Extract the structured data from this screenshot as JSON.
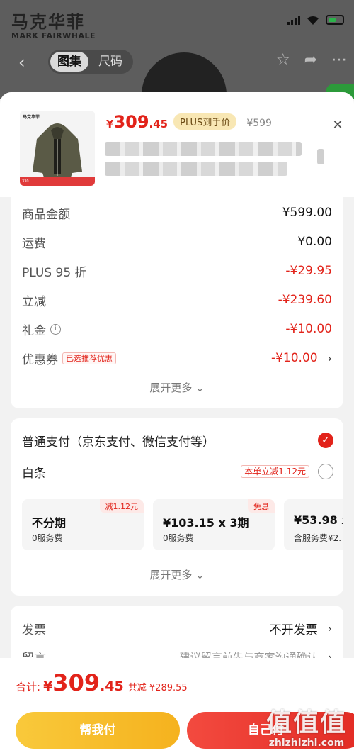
{
  "background": {
    "brand_cn": "马克华菲",
    "brand_en": "MARK FAIRWHALE",
    "tabs": [
      "图集",
      "尺码"
    ]
  },
  "product": {
    "thumb_brand": "马克华菲",
    "price_currency": "¥",
    "price_int": "309",
    "price_dec": ".45",
    "plus_tag": "PLUS到手价",
    "original_price": "¥599"
  },
  "summary": {
    "rows": [
      {
        "label": "商品金额",
        "value": "¥599.00"
      },
      {
        "label": "运费",
        "value": "¥0.00"
      },
      {
        "label": "PLUS 95 折",
        "value": "-¥29.95"
      },
      {
        "label": "立减",
        "value": "-¥239.60"
      },
      {
        "label": "礼金",
        "value": "-¥10.00"
      },
      {
        "label": "优惠券",
        "tag": "已选推荐优惠",
        "value": "-¥10.00"
      }
    ],
    "expand": "展开更多"
  },
  "payment": {
    "normal": "普通支付（京东支付、微信支付等）",
    "baitiao": "白条",
    "baitiao_tag": "本单立减1.12元",
    "installments": [
      {
        "title": "不分期",
        "sub": "0服务费",
        "corner": "减1.12元"
      },
      {
        "title": "¥103.15 x 3期",
        "sub": "0服务费",
        "corner": "免息"
      },
      {
        "title": "¥53.98 x",
        "sub": "含服务费¥2.",
        "corner": ""
      }
    ],
    "expand": "展开更多"
  },
  "invoice": {
    "label": "发票",
    "value": "不开发票",
    "note_label": "留言",
    "note_placeholder": "建议留言前先与商家沟通确认"
  },
  "footer": {
    "total_label": "合计:",
    "total_currency": "¥",
    "total_int": "309",
    "total_dec": ".45",
    "saved": "共减 ¥289.55",
    "help_pay": "帮我付",
    "self_pay": "自己付"
  },
  "watermark": {
    "big": "值值值",
    "small": "zhizhizhi.com"
  }
}
